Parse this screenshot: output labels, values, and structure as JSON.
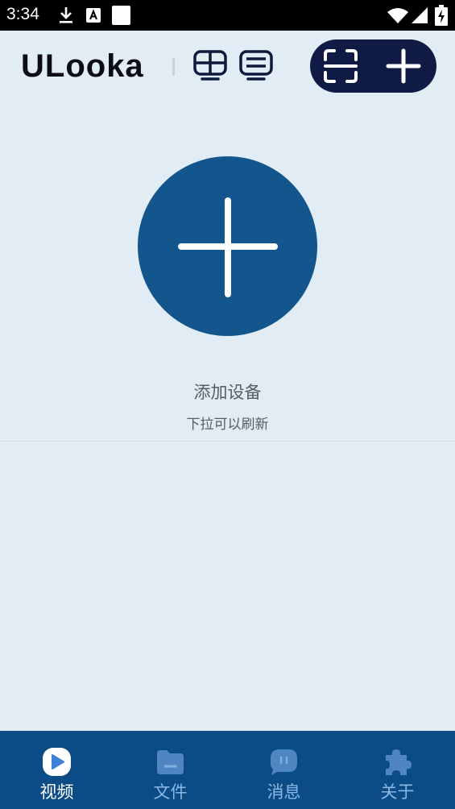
{
  "status_bar": {
    "time": "3:34",
    "icons": [
      "download-icon",
      "a-notification-icon",
      "blank-notification-icon",
      "wifi-icon",
      "signal-icon",
      "battery-charging-icon"
    ]
  },
  "header": {
    "app_name": "ULooka",
    "icons": [
      "grid-view-icon",
      "list-view-icon",
      "scan-icon",
      "plus-icon"
    ]
  },
  "main": {
    "add_device_label": "添加设备",
    "pull_refresh_hint": "下拉可以刷新"
  },
  "tabbar": {
    "tabs": [
      {
        "label": "视频",
        "icon": "video-play-icon",
        "active": true
      },
      {
        "label": "文件",
        "icon": "folder-icon",
        "active": false
      },
      {
        "label": "消息",
        "icon": "message-icon",
        "active": false
      },
      {
        "label": "关于",
        "icon": "puzzle-icon",
        "active": false
      }
    ]
  },
  "colors": {
    "background": "#e2ecf5",
    "primary": "#13568e",
    "tabbar": "#0b4c87",
    "pill": "#0f1b45",
    "tab_inactive": "#8ab8e4"
  }
}
